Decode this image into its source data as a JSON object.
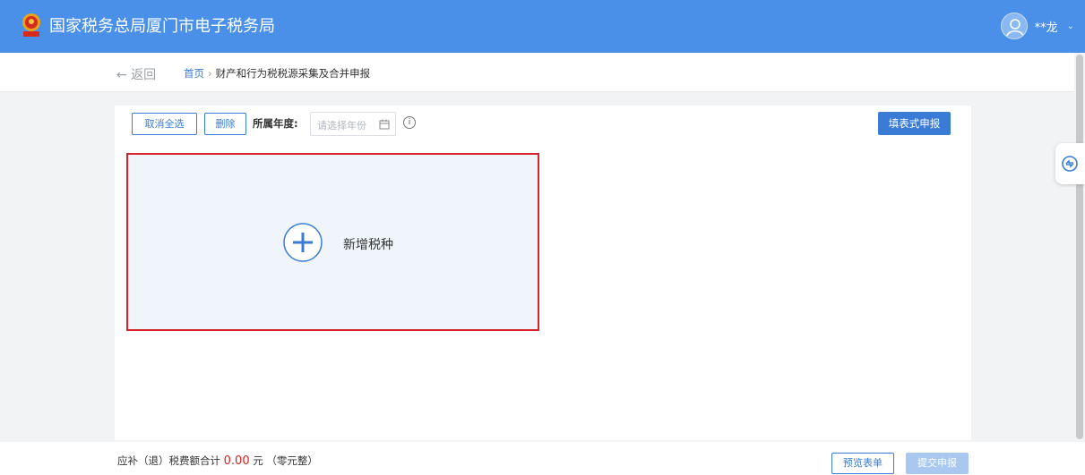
{
  "header": {
    "title": "国家税务总局厦门市电子税务局",
    "username": "**龙",
    "emblem_icon": "national-emblem-icon",
    "user_menu_icon": "chevron-down-icon"
  },
  "nav": {
    "back_label": "← 返回",
    "breadcrumbs": [
      "首页",
      "财产和行为税税源采集及合并申报"
    ]
  },
  "toolbar": {
    "deselect_all_label": "取消全选",
    "delete_label": "删除",
    "year_label": "所属年度:",
    "year_placeholder": "请选择年份",
    "form_declare_label": "填表式申报"
  },
  "card": {
    "add_tax_label": "新增税种",
    "highlight_color": "#d9232a"
  },
  "footer": {
    "total_prefix": "应补（退）税费额合计",
    "total_amount": "0.00",
    "total_unit": "元",
    "total_words": "（零元整）",
    "preview_label": "预览表单",
    "submit_label": "提交申报"
  },
  "colors": {
    "brand": "#4a90e8",
    "accent": "#3a7bd5",
    "amount": "#e02020"
  }
}
